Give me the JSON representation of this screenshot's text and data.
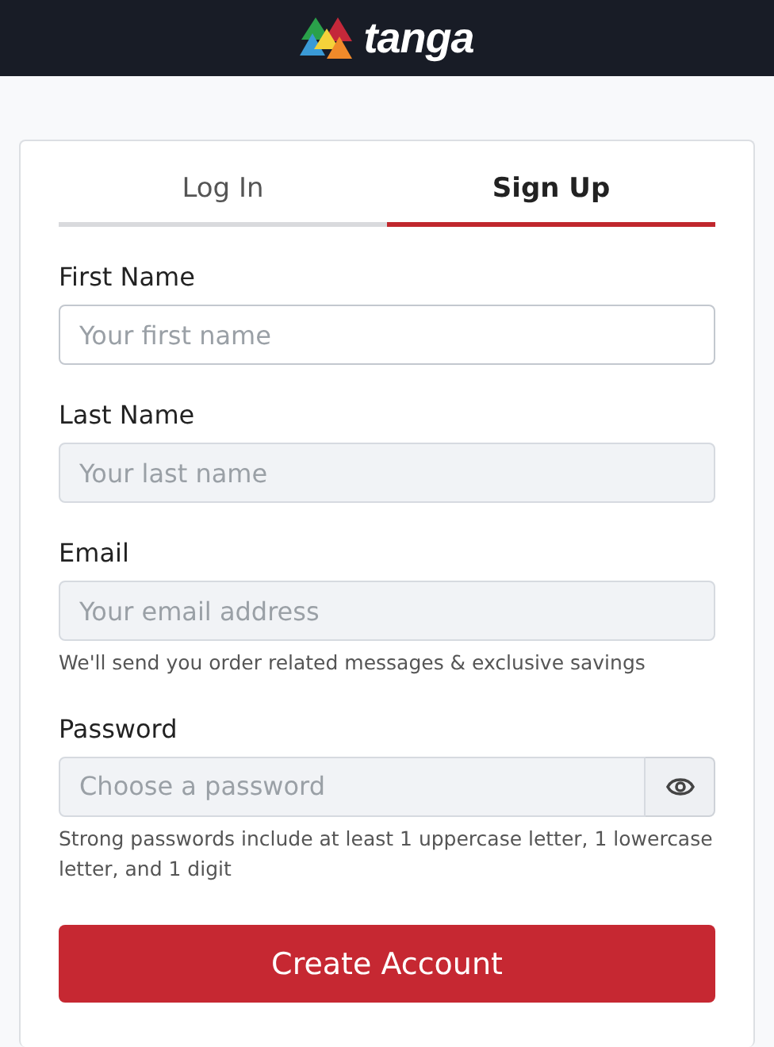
{
  "header": {
    "logo_text": "tanga"
  },
  "tabs": [
    {
      "label": "Log In",
      "selected": false
    },
    {
      "label": "Sign Up",
      "selected": true
    }
  ],
  "fields": [
    {
      "label": "First Name",
      "placeholder": "Your first name",
      "focused": true,
      "kind": "text"
    },
    {
      "label": "Last Name",
      "placeholder": "Your last name",
      "focused": false,
      "kind": "text"
    },
    {
      "label": "Email",
      "placeholder": "Your email address",
      "focused": false,
      "kind": "text",
      "hint": "We'll send you order related messages & exclusive savings"
    },
    {
      "label": "Password",
      "placeholder": "Choose a password",
      "focused": false,
      "kind": "password",
      "hint": "Strong passwords include at least 1 uppercase letter, 1 lowercase letter, and 1 digit"
    }
  ],
  "submit_button": "Create Account"
}
